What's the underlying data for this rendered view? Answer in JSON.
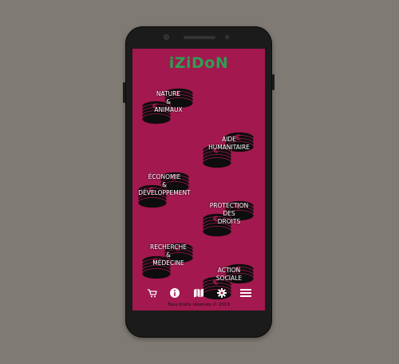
{
  "app": {
    "title": "iZiDoN"
  },
  "categories": [
    {
      "id": "nature",
      "lines": [
        "NATURE",
        "&",
        "ANIMAUX"
      ]
    },
    {
      "id": "aide",
      "lines": [
        "AIDE",
        "HUMANITAIRE"
      ]
    },
    {
      "id": "economie",
      "lines": [
        "ÉCONOMIE",
        "&",
        "DÉVELOPPEMENT"
      ]
    },
    {
      "id": "protection",
      "lines": [
        "PROTECTION",
        "DES",
        "DROITS"
      ]
    },
    {
      "id": "recherche",
      "lines": [
        "RECHERCHE",
        "&",
        "MÉDECINE"
      ]
    },
    {
      "id": "action",
      "lines": [
        "ACTION",
        "SOCIALE"
      ]
    }
  ],
  "navbar": {
    "icons": [
      "cart-icon",
      "info-icon",
      "map-icon",
      "settings-icon",
      "menu-icon"
    ]
  },
  "footer": {
    "copyright": "Tous droits réservés © 2019"
  },
  "colors": {
    "screen_bg": "#a2184f",
    "title": "#2e9e52",
    "coin": "#0d0d0d",
    "coin_accent": "#a2184f",
    "phone_body": "#1b1b1b",
    "background": "#7f7a73"
  }
}
